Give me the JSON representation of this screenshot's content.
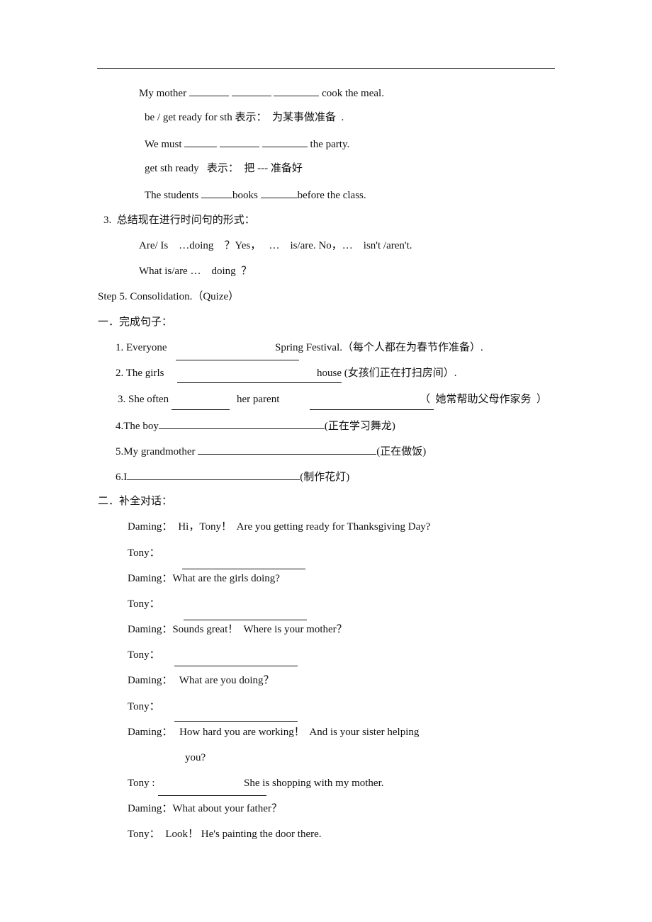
{
  "header": {},
  "notes": {
    "l1_a": "My mother ",
    "l1_b": " cook the meal.",
    "l2": "be / get ready for sth 表示：  为某事做准备  .",
    "l3_a": "We must ",
    "l3_b": " the party.",
    "l4": "get sth ready   表示：  把 --- 准备好",
    "l5_a": "The students ",
    "l5_b": "books ",
    "l5_c": "before the class.",
    "summary_title": "3.  总结现在进行时问句的形式：",
    "summary_1": "Are/ Is    …doing    ？Yes，   …    is/are. No，…    isn't /aren't.",
    "summary_2": "What is/are …    doing  ？"
  },
  "step5": {
    "title": "Step 5. Consolidation.（Quize）",
    "part1_title": "一．完成句子：",
    "items": [
      {
        "a": "1. Everyone",
        "b": "Spring Festival.（每个人都在为春节作准备）."
      },
      {
        "a": "2. The girls",
        "b": "house (女孩们正在打扫房间）."
      },
      {
        "a": "3. She often",
        "b": "her parent",
        "c": "（  她常帮助父母作家务  ）"
      },
      {
        "a": "4.The boy",
        "b": "(正在学习舞龙)"
      },
      {
        "a": "5.My grandmother ",
        "b": "(正在做饭)"
      },
      {
        "a": "6.I",
        "b": "(制作花灯)"
      }
    ],
    "part2_title": "二．补全对话：",
    "dialogue": [
      {
        "speaker": "Daming：",
        "text": "Hi，Tony！  Are you getting ready for Thanksgiving Day?"
      },
      {
        "speaker": "Tony：",
        "text": ""
      },
      {
        "speaker": "Daming：",
        "text": "What are the girls doing?"
      },
      {
        "speaker": "Tony：",
        "text": ""
      },
      {
        "speaker": "Daming：",
        "text": "Sounds great！  Where is your mother？"
      },
      {
        "speaker": "Tony：",
        "text": ""
      },
      {
        "speaker": "Daming：",
        "text": " What are you doing？"
      },
      {
        "speaker": "Tony：",
        "text": ""
      },
      {
        "speaker": "Daming：",
        "text": " How hard you are working！  And is your sister helping"
      },
      {
        "speaker": "",
        "text": "you?"
      },
      {
        "speaker": "Tony :",
        "text": "She is shopping with my mother."
      },
      {
        "speaker": "Daming：",
        "text": "What about your father？"
      },
      {
        "speaker": "Tony：",
        "text": " Look！ He's painting the door there."
      }
    ]
  }
}
